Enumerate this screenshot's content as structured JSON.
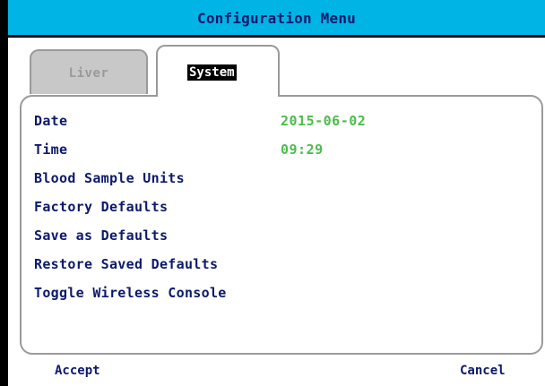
{
  "window": {
    "title": "Configuration Menu"
  },
  "tabs": [
    {
      "label": "Liver",
      "active": false
    },
    {
      "label": "System",
      "active": true
    }
  ],
  "menu": {
    "items": [
      {
        "label": "Date",
        "value": "2015-06-02"
      },
      {
        "label": "Time",
        "value": "09:29"
      },
      {
        "label": "Blood Sample Units",
        "value": ""
      },
      {
        "label": "Factory Defaults",
        "value": ""
      },
      {
        "label": "Save as Defaults",
        "value": ""
      },
      {
        "label": "Restore Saved Defaults",
        "value": ""
      },
      {
        "label": "Toggle Wireless Console",
        "value": ""
      }
    ]
  },
  "footer": {
    "accept_label": "Accept",
    "cancel_label": "Cancel"
  },
  "colors": {
    "title_bar": "#00b4e6",
    "label_text": "#0c1a6b",
    "value_text": "#4cbc4c",
    "inactive_tab": "#c8c8c8"
  }
}
